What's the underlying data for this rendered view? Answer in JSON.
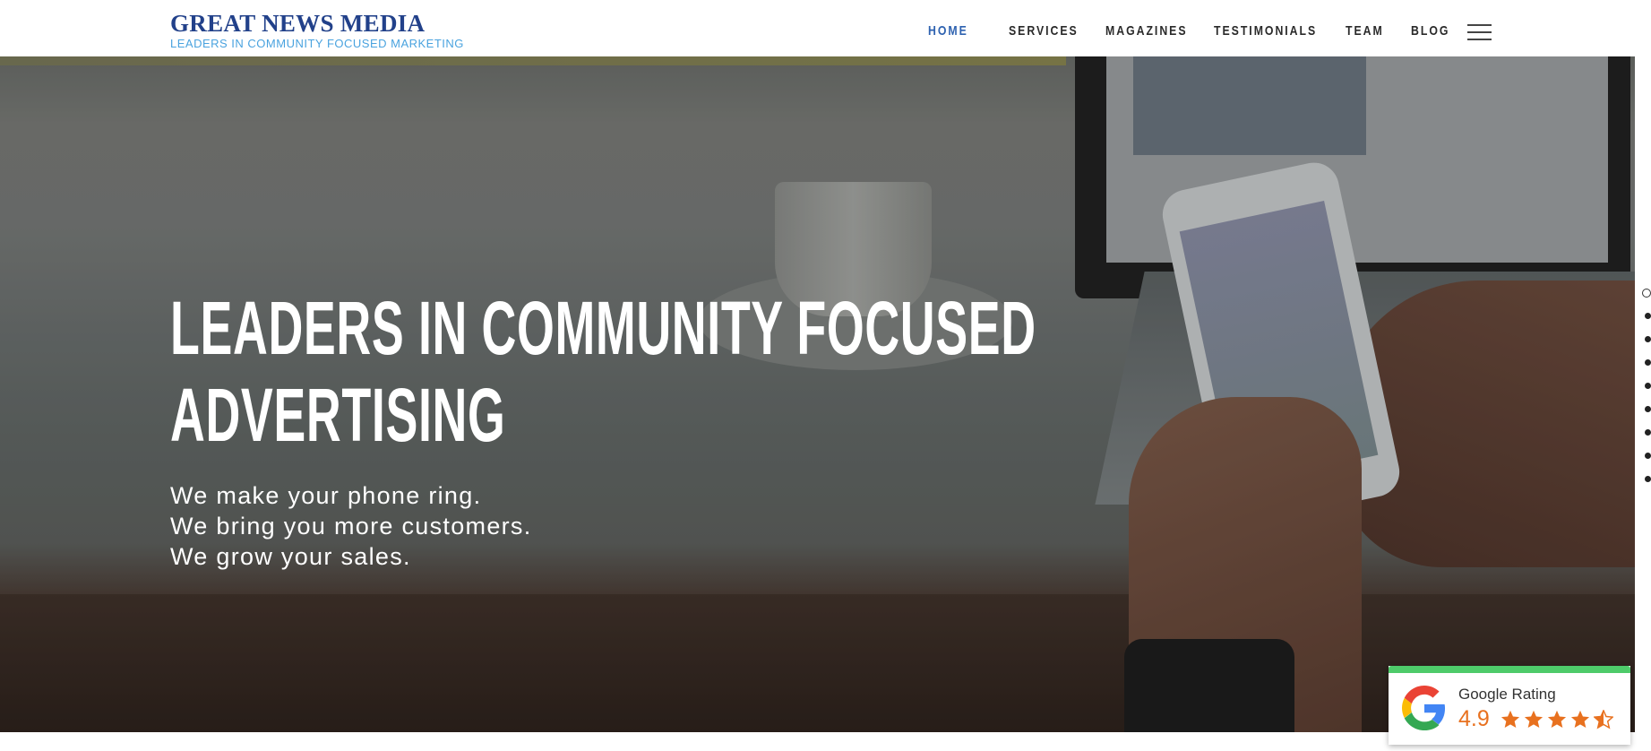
{
  "header": {
    "logo_title": "GREAT NEWS MEDIA",
    "logo_tagline": "LEADERS IN COMMUNITY FOCUSED MARKETING",
    "nav": [
      {
        "label": "HOME",
        "active": true
      },
      {
        "label": "SERVICES"
      },
      {
        "label": "MAGAZINES"
      },
      {
        "label": "TESTIMONIALS"
      },
      {
        "label": "TEAM"
      },
      {
        "label": "BLOG"
      }
    ],
    "menu_icon": "hamburger-icon"
  },
  "hero": {
    "headline_line1": "LEADERS IN COMMUNITY FOCUSED",
    "headline_line2": "ADVERTISING",
    "sub_lines": [
      "We make your phone ring.",
      "We bring you more customers.",
      "We grow your sales."
    ],
    "slide_count": 9,
    "active_slide": 1
  },
  "rating_badge": {
    "label": "Google Rating",
    "score": "4.9",
    "stars": 4.5,
    "icon": "google-g-icon",
    "colors": {
      "accent_bar": "#4ecb6a",
      "score": "#e8711f"
    }
  },
  "colors": {
    "brand": "#22418a",
    "tagline": "#4aa3df",
    "nav_active": "#2e62b0"
  }
}
